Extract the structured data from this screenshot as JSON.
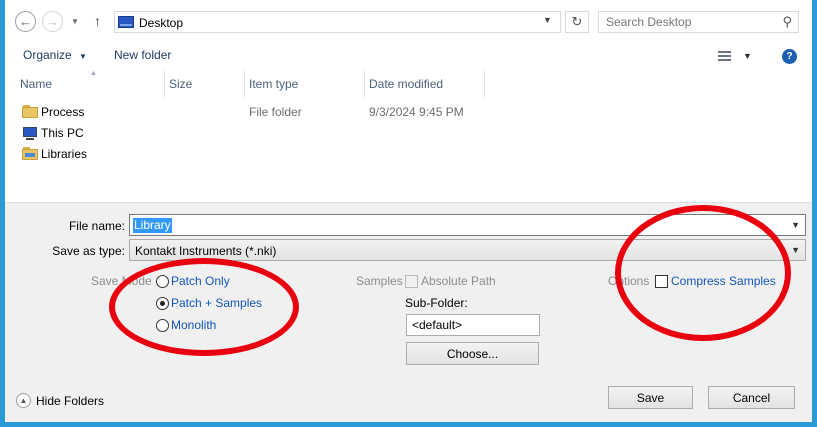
{
  "address": {
    "location": "Desktop"
  },
  "search": {
    "placeholder": "Search Desktop"
  },
  "commands": {
    "organize": "Organize",
    "new_folder": "New folder"
  },
  "columns": {
    "name": "Name",
    "size": "Size",
    "type": "Item type",
    "date": "Date modified"
  },
  "files": [
    {
      "name": "Process",
      "type": "File folder",
      "date": "9/3/2024 9:45 PM",
      "icon": "folder-icon"
    },
    {
      "name": "This PC",
      "type": "",
      "date": "",
      "icon": "computer-icon"
    },
    {
      "name": "Libraries",
      "type": "",
      "date": "",
      "icon": "library-icon"
    }
  ],
  "form": {
    "file_name_label": "File name:",
    "file_name_value": "Library",
    "save_type_label": "Save as type:",
    "save_type_value": "Kontakt Instruments (*.nki)",
    "save_mode_label": "Save Mode",
    "modes": [
      "Patch Only",
      "Patch + Samples",
      "Monolith"
    ],
    "selected_mode": "Patch + Samples",
    "samples_label": "Samples",
    "absolute_path_label": "Absolute Path",
    "subfolder_label": "Sub-Folder:",
    "subfolder_value": "<default>",
    "choose_label": "Choose...",
    "options_label": "Options",
    "compress_label": "Compress Samples"
  },
  "footer": {
    "hide_folders": "Hide Folders",
    "save": "Save",
    "cancel": "Cancel"
  },
  "colors": {
    "annotation": "#e8000f",
    "selection": "#3399ff",
    "frame": "#2b9bd8"
  }
}
